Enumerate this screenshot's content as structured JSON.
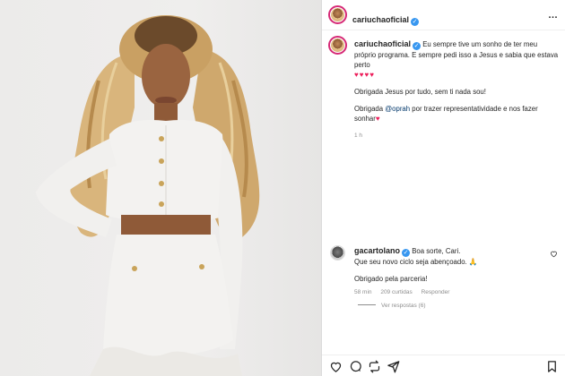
{
  "post": {
    "username": "cariuchaoficial",
    "caption_line1": "Eu sempre tive um sonho de ter meu próprio programa. E sempre pedi isso a Jesus e sabia que estava perto",
    "hearts": "♥♥♥♥",
    "caption_line2": "Obrigada Jesus por tudo, sem ti nada sou!",
    "caption_line3_pre": "Obrigada ",
    "mention": "@oprah",
    "caption_line3_post": " por trazer representatividade e nos fazer sonhar",
    "caption_heart": "♥",
    "time": "1 h"
  },
  "comment": {
    "username": "gacartolano",
    "text_line1": "Boa sorte, Cari.",
    "text_line2": "Que seu novo ciclo seja abençoado. 🙏",
    "text_line3": "Obrigado pela parceria!",
    "time": "58 min",
    "likes": "209 curtidas",
    "reply": "Responder",
    "view_replies": "Ver respostas (6)"
  },
  "icons": {
    "verified": "✓",
    "more": "…",
    "heart": "heart-icon",
    "comment": "comment-icon",
    "share": "share-icon",
    "bookmark": "bookmark-icon"
  },
  "colors": {
    "accent": "#3897f0",
    "mention": "#00376b",
    "heart": "#ed1e5a"
  }
}
